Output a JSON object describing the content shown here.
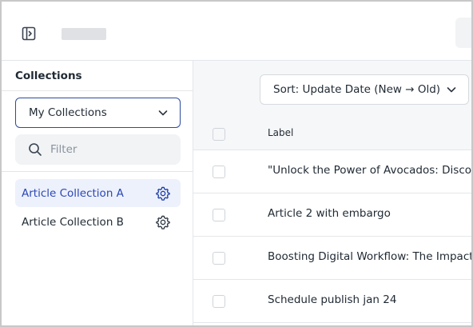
{
  "sidebar": {
    "heading": "Collections",
    "collection_select": {
      "selected": "My Collections"
    },
    "filter": {
      "placeholder": "Filter",
      "value": ""
    },
    "items": [
      {
        "label": "Article Collection A",
        "active": true
      },
      {
        "label": "Article Collection B",
        "active": false
      }
    ]
  },
  "toolbar": {
    "sort_label": "Sort: Update Date (New → Old)"
  },
  "table": {
    "columns": [
      "Label"
    ],
    "rows": [
      {
        "label": "\"Unlock the Power of Avocados: Discover"
      },
      {
        "label": "Article 2 with embargo"
      },
      {
        "label": "Boosting Digital Workflow: The Impact"
      },
      {
        "label": "Schedule publish jan 24"
      }
    ]
  },
  "icons": {
    "sidebar_toggle": "sidebar-toggle-icon",
    "chevron": "chevron-down-icon",
    "search": "search-icon",
    "gear": "gear-icon"
  },
  "colors": {
    "accent": "#2e4a9e",
    "active_item_bg": "#edf1fc",
    "active_item_text": "#2a47b4",
    "surface_muted": "#f6f7f9"
  }
}
